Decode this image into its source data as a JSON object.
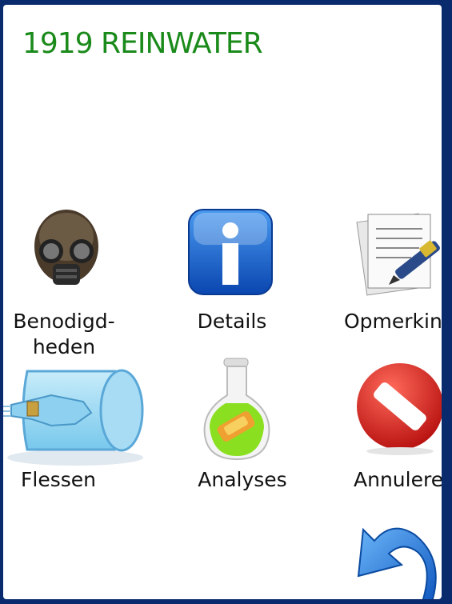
{
  "title": "1919 REINWATER",
  "tiles": [
    {
      "label": "Benodigd-\nheden",
      "icon": "gas-mask-icon"
    },
    {
      "label": "Details",
      "icon": "info-icon"
    },
    {
      "label": "Opmerking",
      "icon": "notes-icon"
    },
    {
      "label": "Flessen",
      "icon": "bottle-icon"
    },
    {
      "label": "Analyses",
      "icon": "flask-icon"
    },
    {
      "label": "Annuleren",
      "icon": "cancel-icon"
    }
  ],
  "back": {
    "icon": "back-arrow-icon"
  },
  "colors": {
    "title": "#1a8a1a",
    "frame": "#0a2a6e",
    "info": "#1560c8",
    "cancel": "#d01818"
  }
}
